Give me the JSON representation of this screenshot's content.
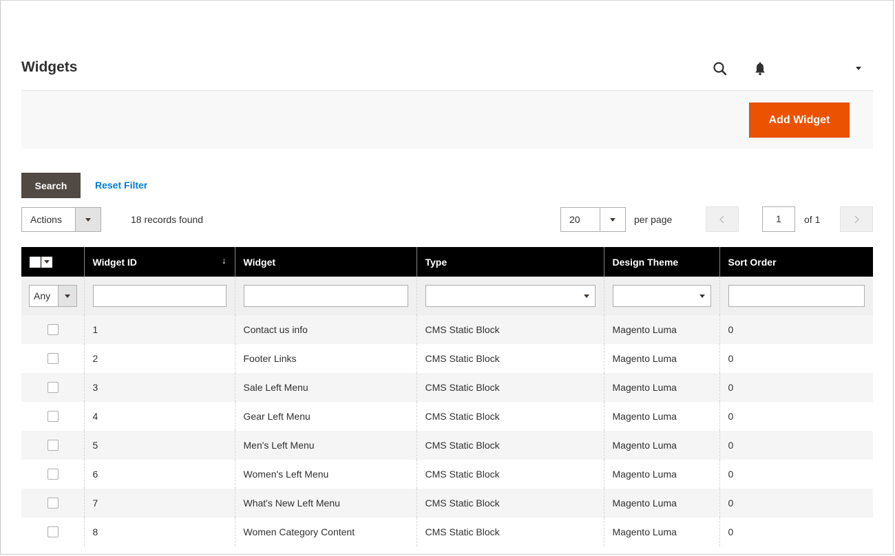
{
  "page": {
    "title": "Widgets",
    "add_button": "Add Widget"
  },
  "header": {
    "icons": [
      "search-icon",
      "bell-icon",
      "chevron-down-icon"
    ]
  },
  "toolbar": {
    "search_label": "Search",
    "reset_label": "Reset Filter",
    "actions_label": "Actions",
    "records_text": "18 records found",
    "per_page_value": "20",
    "per_page_label": "per page",
    "page_value": "1",
    "page_of": "of 1",
    "prev_glyph": "‹",
    "next_glyph": "›"
  },
  "table": {
    "columns": [
      "Widget ID",
      "Widget",
      "Type",
      "Design Theme",
      "Sort Order"
    ],
    "sort_glyph": "↓",
    "filters": {
      "any_label": "Any"
    },
    "rows": [
      {
        "id": "1",
        "widget": "Contact us info",
        "type": "CMS Static Block",
        "theme": "Magento Luma",
        "sort": "0"
      },
      {
        "id": "2",
        "widget": "Footer Links",
        "type": "CMS Static Block",
        "theme": "Magento Luma",
        "sort": "0"
      },
      {
        "id": "3",
        "widget": "Sale Left Menu",
        "type": "CMS Static Block",
        "theme": "Magento Luma",
        "sort": "0"
      },
      {
        "id": "4",
        "widget": "Gear Left Menu",
        "type": "CMS Static Block",
        "theme": "Magento Luma",
        "sort": "0"
      },
      {
        "id": "5",
        "widget": "Men's Left Menu",
        "type": "CMS Static Block",
        "theme": "Magento Luma",
        "sort": "0"
      },
      {
        "id": "6",
        "widget": "Women's Left Menu",
        "type": "CMS Static Block",
        "theme": "Magento Luma",
        "sort": "0"
      },
      {
        "id": "7",
        "widget": "What's New Left Menu",
        "type": "CMS Static Block",
        "theme": "Magento Luma",
        "sort": "0"
      },
      {
        "id": "8",
        "widget": "Women Category Content",
        "type": "CMS Static Block",
        "theme": "Magento Luma",
        "sort": "0"
      }
    ]
  },
  "colors": {
    "accent": "#eb5202",
    "search_button": "#514943",
    "link": "#007bdb",
    "table_header": "#000000"
  }
}
